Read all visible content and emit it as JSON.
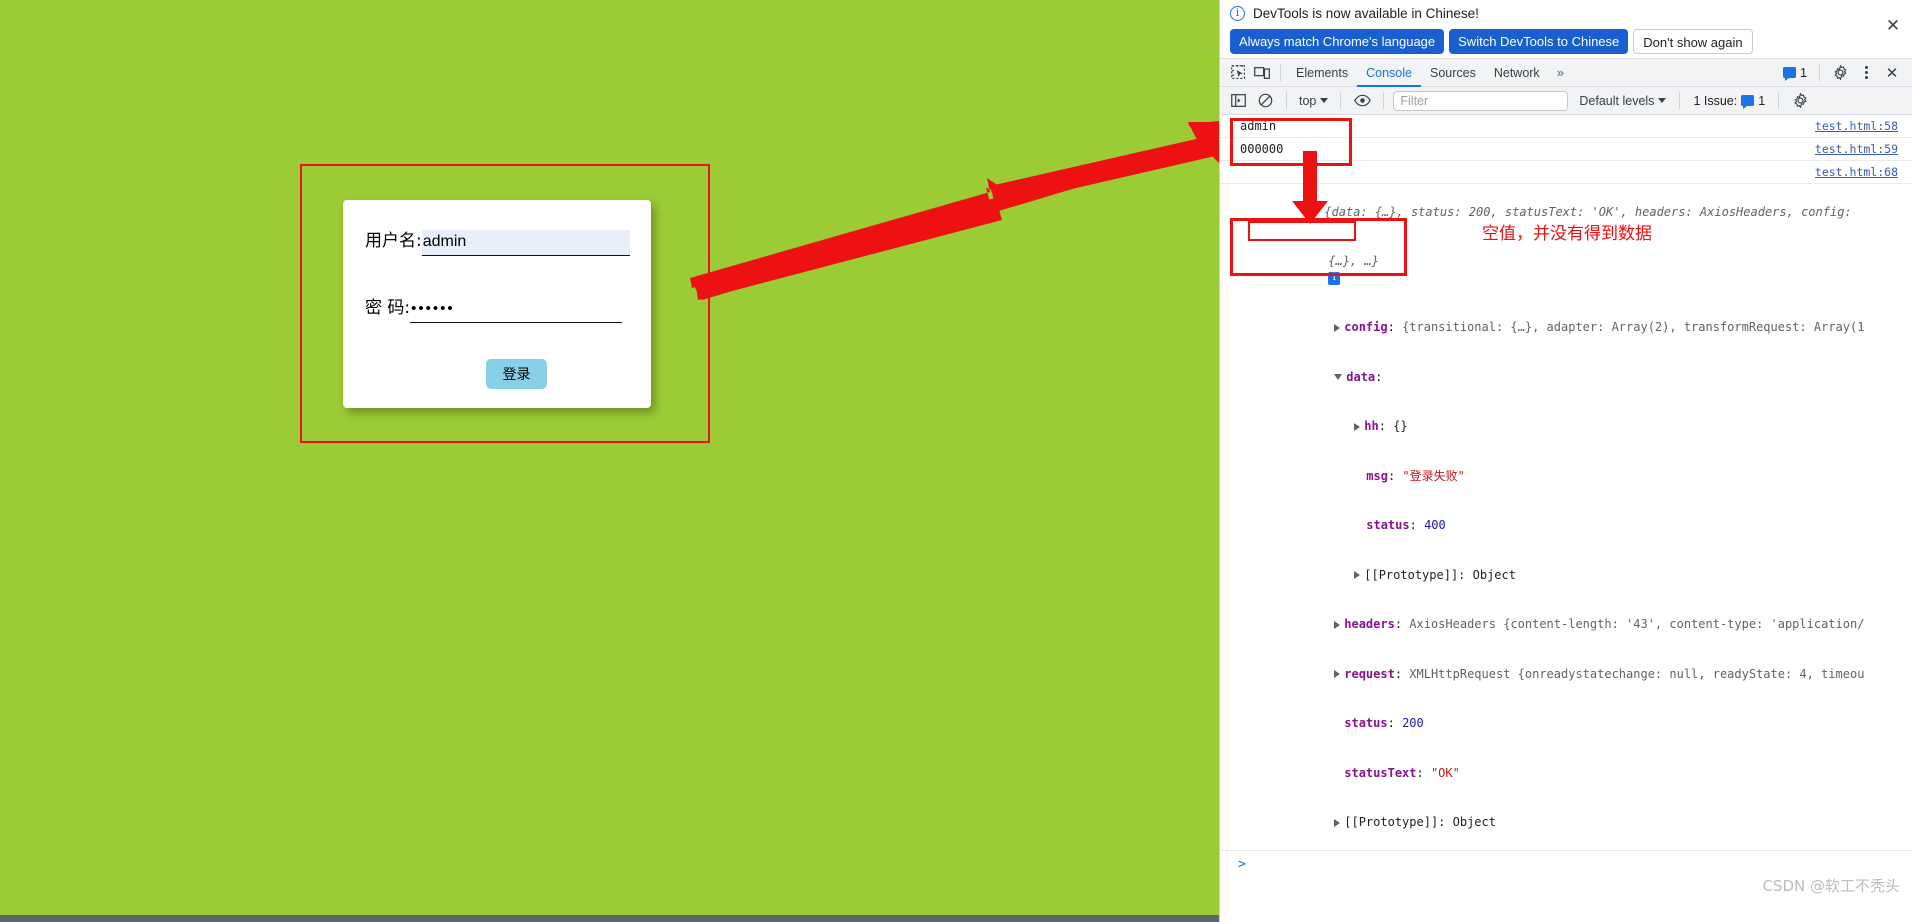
{
  "page": {
    "background_color": "#9BCB35",
    "login": {
      "username_label": "用户名:",
      "username_value": "admin",
      "password_label": "密 码:",
      "password_value": "••••••",
      "submit_label": "登录"
    }
  },
  "devtools": {
    "notification": {
      "info_icon": "info-icon",
      "text": "DevTools is now available in Chinese!",
      "primary_button": "Always match Chrome's language",
      "secondary_button": "Switch DevTools to Chinese",
      "ghost_button": "Don't show again",
      "close_icon": "✕"
    },
    "tabs": {
      "inspect_icon": "inspect-element-icon",
      "device_icon": "device-toolbar-icon",
      "items": [
        {
          "label": "Elements",
          "active": false
        },
        {
          "label": "Console",
          "active": true
        },
        {
          "label": "Sources",
          "active": false
        },
        {
          "label": "Network",
          "active": false
        }
      ],
      "more_label": "»",
      "issues_count": "1",
      "settings_icon": "gear-icon",
      "menu_icon": "kebab-menu-icon",
      "close_icon": "✕"
    },
    "toolbar": {
      "sidebar_icon": "console-sidebar-icon",
      "clear_icon": "clear-console-icon",
      "context_value": "top",
      "eye_icon": "live-expression-icon",
      "filter_placeholder": "Filter",
      "filter_value": "",
      "levels_value": "Default levels",
      "issues_label": "1 Issue:",
      "issues_count": "1",
      "settings_icon": "console-settings-icon"
    },
    "console": {
      "rows": [
        {
          "message": "admin",
          "source": "test.html:58"
        },
        {
          "message": "000000",
          "source": "test.html:59"
        },
        {
          "message": "",
          "source": "test.html:68"
        }
      ],
      "object": {
        "summary_line1": "{data: {…}, status: 200, statusText: 'OK', headers: AxiosHeaders, config:",
        "summary_line2": "{…}, …}",
        "summary_badge": "i",
        "summary_status_key": "status:",
        "summary_status_value": "200",
        "summary_statustext_key": "statusText:",
        "summary_statustext_value": "'OK'",
        "config_key": "config",
        "config_value": "{transitional: {…}, adapter: Array(2), transformRequest: Array(1",
        "data_key": "data",
        "data_children": [
          {
            "key": "hh",
            "value": "{}",
            "expandable": true
          },
          {
            "key": "msg",
            "value": "\"登录失败\"",
            "type": "string"
          },
          {
            "key": "status",
            "value": "400",
            "type": "number"
          }
        ],
        "data_prototype": "[[Prototype]]: Object",
        "headers_key": "headers",
        "headers_value": "AxiosHeaders {content-length: '43', content-type: 'application/",
        "request_key": "request",
        "request_value": "XMLHttpRequest {onreadystatechange: null, readyState: 4, timeou",
        "status_key": "status",
        "status_value": "200",
        "statustext_key": "statusText",
        "statustext_value": "\"OK\"",
        "prototype": "[[Prototype]]: Object"
      },
      "prompt": ">"
    }
  },
  "annotations": {
    "color": "#EE1111",
    "note_text": "空值，并没有得到数据",
    "arrow_login_to_console": "red-arrow-diagonal",
    "arrow_inputs_to_data": "red-arrow-down",
    "box_login": "red-box-login-form",
    "box_console_inputs": "red-box-console-inputs",
    "box_console_data": "red-box-console-data",
    "box_console_hh": "red-box-console-hh"
  },
  "watermark": {
    "text": "CSDN @软工不秃头"
  }
}
